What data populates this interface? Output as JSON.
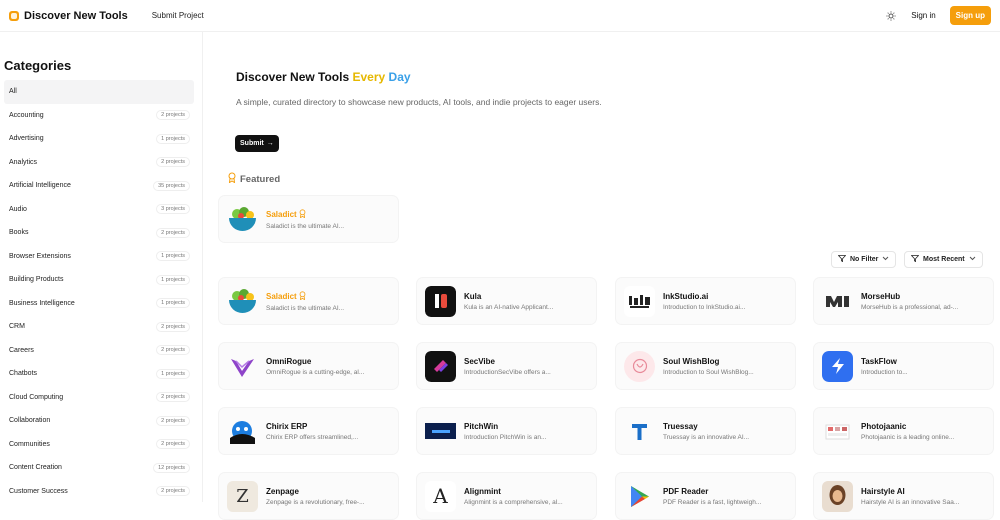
{
  "header": {
    "brand": "Discover New Tools",
    "nav_submit": "Submit Project",
    "signin": "Sign in",
    "signup": "Sign up"
  },
  "sidebar": {
    "title": "Categories",
    "items": [
      {
        "label": "All",
        "count": ""
      },
      {
        "label": "Accounting",
        "count": "2 projects"
      },
      {
        "label": "Advertising",
        "count": "1 projects"
      },
      {
        "label": "Analytics",
        "count": "2 projects"
      },
      {
        "label": "Artificial Intelligence",
        "count": "35 projects"
      },
      {
        "label": "Audio",
        "count": "3 projects"
      },
      {
        "label": "Books",
        "count": "2 projects"
      },
      {
        "label": "Browser Extensions",
        "count": "1 projects"
      },
      {
        "label": "Building Products",
        "count": "1 projects"
      },
      {
        "label": "Business Intelligence",
        "count": "1 projects"
      },
      {
        "label": "CRM",
        "count": "2 projects"
      },
      {
        "label": "Careers",
        "count": "2 projects"
      },
      {
        "label": "Chatbots",
        "count": "1 projects"
      },
      {
        "label": "Cloud Computing",
        "count": "2 projects"
      },
      {
        "label": "Collaboration",
        "count": "2 projects"
      },
      {
        "label": "Communities",
        "count": "2 projects"
      },
      {
        "label": "Content Creation",
        "count": "12 projects"
      },
      {
        "label": "Customer Success",
        "count": "2 projects"
      }
    ]
  },
  "hero": {
    "title_main": "Discover New Tools",
    "title_every": "Every",
    "title_day": "Day",
    "description": "A simple, curated directory to showcase new products, AI tools, and indie projects to eager users.",
    "submit": "Submit"
  },
  "featured": {
    "heading": "Featured",
    "card": {
      "title": "Saladict",
      "desc": "Saladict is the ultimate AI..."
    }
  },
  "filters": {
    "filter_label": "No Filter",
    "sort_label": "Most Recent"
  },
  "tools": [
    {
      "title": "Saladict",
      "desc": "Saladict is the ultimate AI...",
      "icon": "salad-bowl-icon",
      "featured": true
    },
    {
      "title": "Kula",
      "desc": "Kula is an AI-native Applicant...",
      "icon": "kula-logo-icon"
    },
    {
      "title": "InkStudio.ai",
      "desc": "Introduction to InkStudio.ai...",
      "icon": "inkstudio-logo-icon"
    },
    {
      "title": "MorseHub",
      "desc": "MorseHub is a professional, ad-...",
      "icon": "morsehub-logo-icon"
    },
    {
      "title": "OmniRogue",
      "desc": "OmniRogue is a cutting-edge, al...",
      "icon": "omnirogue-logo-icon"
    },
    {
      "title": "SecVibe",
      "desc": "IntroductionSecVibe offers a...",
      "icon": "secvibe-logo-icon"
    },
    {
      "title": "Soul WishBlog",
      "desc": "Introduction to Soul WishBlog...",
      "icon": "soulwishblog-logo-icon"
    },
    {
      "title": "TaskFlow",
      "desc": "Introduction to...",
      "icon": "taskflow-bolt-icon"
    },
    {
      "title": "Chirix ERP",
      "desc": "Chirix ERP offers streamlined,...",
      "icon": "chirix-logo-icon"
    },
    {
      "title": "PitchWin",
      "desc": "Introduction PitchWin is an...",
      "icon": "pitchwin-logo-icon"
    },
    {
      "title": "Truessay",
      "desc": "Truessay is an innovative AI...",
      "icon": "truessay-logo-icon"
    },
    {
      "title": "Photojaanic",
      "desc": "Photojaanic is a leading online...",
      "icon": "photojaanic-logo-icon"
    },
    {
      "title": "Zenpage",
      "desc": "Zenpage is a revolutionary, free-...",
      "icon": "zenpage-logo-icon"
    },
    {
      "title": "Alignmint",
      "desc": "Alignmint is a comprehensive, al...",
      "icon": "alignmint-logo-icon"
    },
    {
      "title": "PDF Reader",
      "desc": "PDF Reader is a fast, lightweigh...",
      "icon": "pdf-reader-logo-icon"
    },
    {
      "title": "Hairstyle AI",
      "desc": "Hairstyle AI is an innovative Saa...",
      "icon": "hairstyle-logo-icon"
    }
  ],
  "colors": {
    "accent": "#f59e0b",
    "every": "#e6b800",
    "day": "#3aa0e8"
  }
}
